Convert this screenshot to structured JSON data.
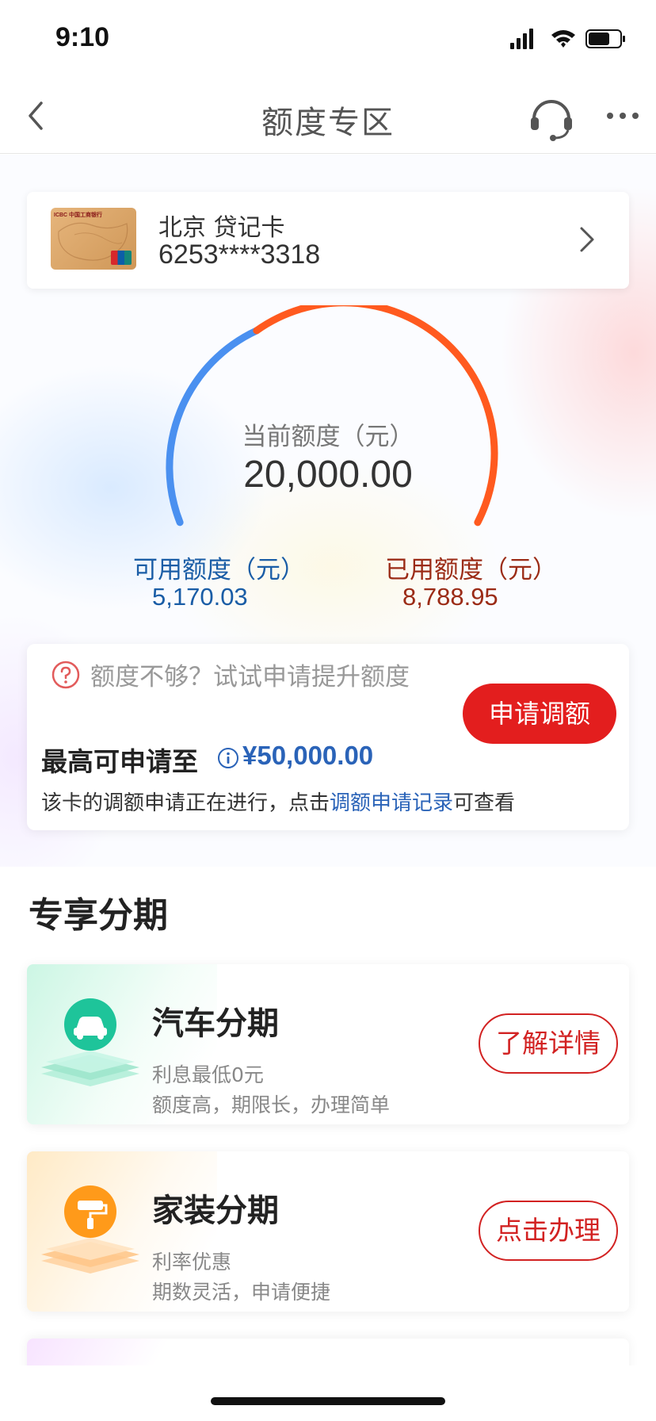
{
  "status_bar": {
    "time": "9:10"
  },
  "nav": {
    "title": "额度专区"
  },
  "card": {
    "name": "北京 贷记卡",
    "number": "6253****3318",
    "logo_text": "ICBC 中国工商银行"
  },
  "gauge": {
    "current_label": "当前额度（元）",
    "current_value": "20,000.00",
    "available_label": "可用额度（元）",
    "available_value": "5,170.03",
    "used_label": "已用额度（元）",
    "used_value": "8,788.95",
    "colors": {
      "available": "#4a90f0",
      "used": "#ff5a1f"
    }
  },
  "increase": {
    "prompt": "额度不够？试试申请提升额度",
    "max_label": "最高可申请至",
    "max_value": "¥50,000.00",
    "note_prefix": "该卡的调额申请正在进行，点击",
    "note_link": "调额申请记录",
    "note_suffix": "可查看",
    "apply_button": "申请调额"
  },
  "section": {
    "title": "专享分期"
  },
  "offers": [
    {
      "title": "汽车分期",
      "desc1": "利息最低0元",
      "desc2": "额度高，期限长，办理简单",
      "button": "了解详情",
      "icon": "car-icon"
    },
    {
      "title": "家装分期",
      "desc1": "利率优惠",
      "desc2": "期数灵活，申请便捷",
      "button": "点击办理",
      "icon": "paint-roller-icon"
    }
  ],
  "theme": {
    "accent_red": "#e31e1e",
    "link_blue": "#2a63b8"
  }
}
